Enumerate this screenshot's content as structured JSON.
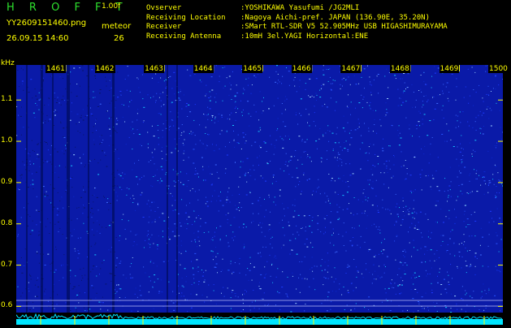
{
  "header": {
    "brand": "H R O F F T",
    "version": "1.00f",
    "filename": "YY2609151460.png",
    "meteor_label": "meteor",
    "datetime": "26.09.15 14:60",
    "meteor_count": "26",
    "info": [
      {
        "key": "Ovserver",
        "value": ":YOSHIKAWA Yasufumi /JG2MLI"
      },
      {
        "key": "Receiving Location",
        "value": ":Nagoya Aichi-pref. JAPAN (136.90E, 35.20N)"
      },
      {
        "key": "Receiver",
        "value": ":SMart RTL-SDR V5 52.905MHz USB HIGASHIMURAYAMA"
      },
      {
        "key": "Receiving Antenna",
        "value": ":10mH 3el.YAGI Horizontal:ENE"
      }
    ]
  },
  "axis": {
    "unit": "kHz",
    "y_ticks": [
      "1.1",
      "1.0",
      "0.9",
      "0.8",
      "0.7",
      "0.6"
    ],
    "y_values": [
      1.1,
      1.0,
      0.9,
      0.8,
      0.7,
      0.6
    ],
    "y_range": [
      0.585,
      1.185
    ],
    "x_ticks": [
      "1461",
      "1462",
      "1463",
      "1464",
      "1465",
      "1466",
      "1467",
      "1468",
      "1469",
      "1500"
    ]
  },
  "colors": {
    "background": "#0a1aa8",
    "accent_text": "#ffff00",
    "brand": "#2ee02e",
    "trace": "#00e5ff"
  }
}
